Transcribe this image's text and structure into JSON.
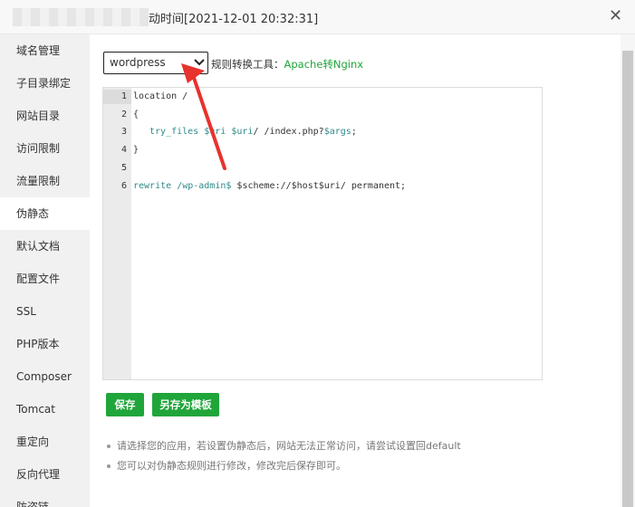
{
  "dialog": {
    "title_visible": "动时间[2021-12-01 20:32:31]",
    "close_glyph": "✕"
  },
  "sidebar": {
    "items": [
      {
        "label": "域名管理"
      },
      {
        "label": "子目录绑定"
      },
      {
        "label": "网站目录"
      },
      {
        "label": "访问限制"
      },
      {
        "label": "流量限制"
      },
      {
        "label": "伪静态",
        "active": true
      },
      {
        "label": "默认文档"
      },
      {
        "label": "配置文件"
      },
      {
        "label": "SSL"
      },
      {
        "label": "PHP版本"
      },
      {
        "label": "Composer"
      },
      {
        "label": "Tomcat"
      },
      {
        "label": "重定向"
      },
      {
        "label": "反向代理"
      },
      {
        "label": "防盗链"
      }
    ]
  },
  "rewrite": {
    "selected_template": "wordpress",
    "convert_label": "规则转换工具：",
    "convert_link": "Apache转Nginx"
  },
  "editor": {
    "line_numbers": [
      "1",
      "2",
      "3",
      "4",
      "5",
      "6"
    ],
    "lines": {
      "l1": "location /",
      "l2": "{",
      "l3_kw": "try_files",
      "l3_v1": "$uri",
      "l3_v2": "$uri",
      "l3_mid": "/ /index.php?",
      "l3_v3": "$args",
      "l3_end": ";",
      "l4": "}",
      "l6_kw": "rewrite",
      "l6_path": "/wp-admin$",
      "l6_rest": " $scheme://$host$uri/ permanent;"
    }
  },
  "buttons": {
    "save": "保存",
    "save_as_template": "另存为模板"
  },
  "tips": [
    "请选择您的应用，若设置伪静态后，网站无法正常访问，请尝试设置回default",
    "您可以对伪静态规则进行修改，修改完后保存即可。"
  ],
  "colors": {
    "accent_green": "#20a53a",
    "annotation_arrow": "#e8322d"
  }
}
